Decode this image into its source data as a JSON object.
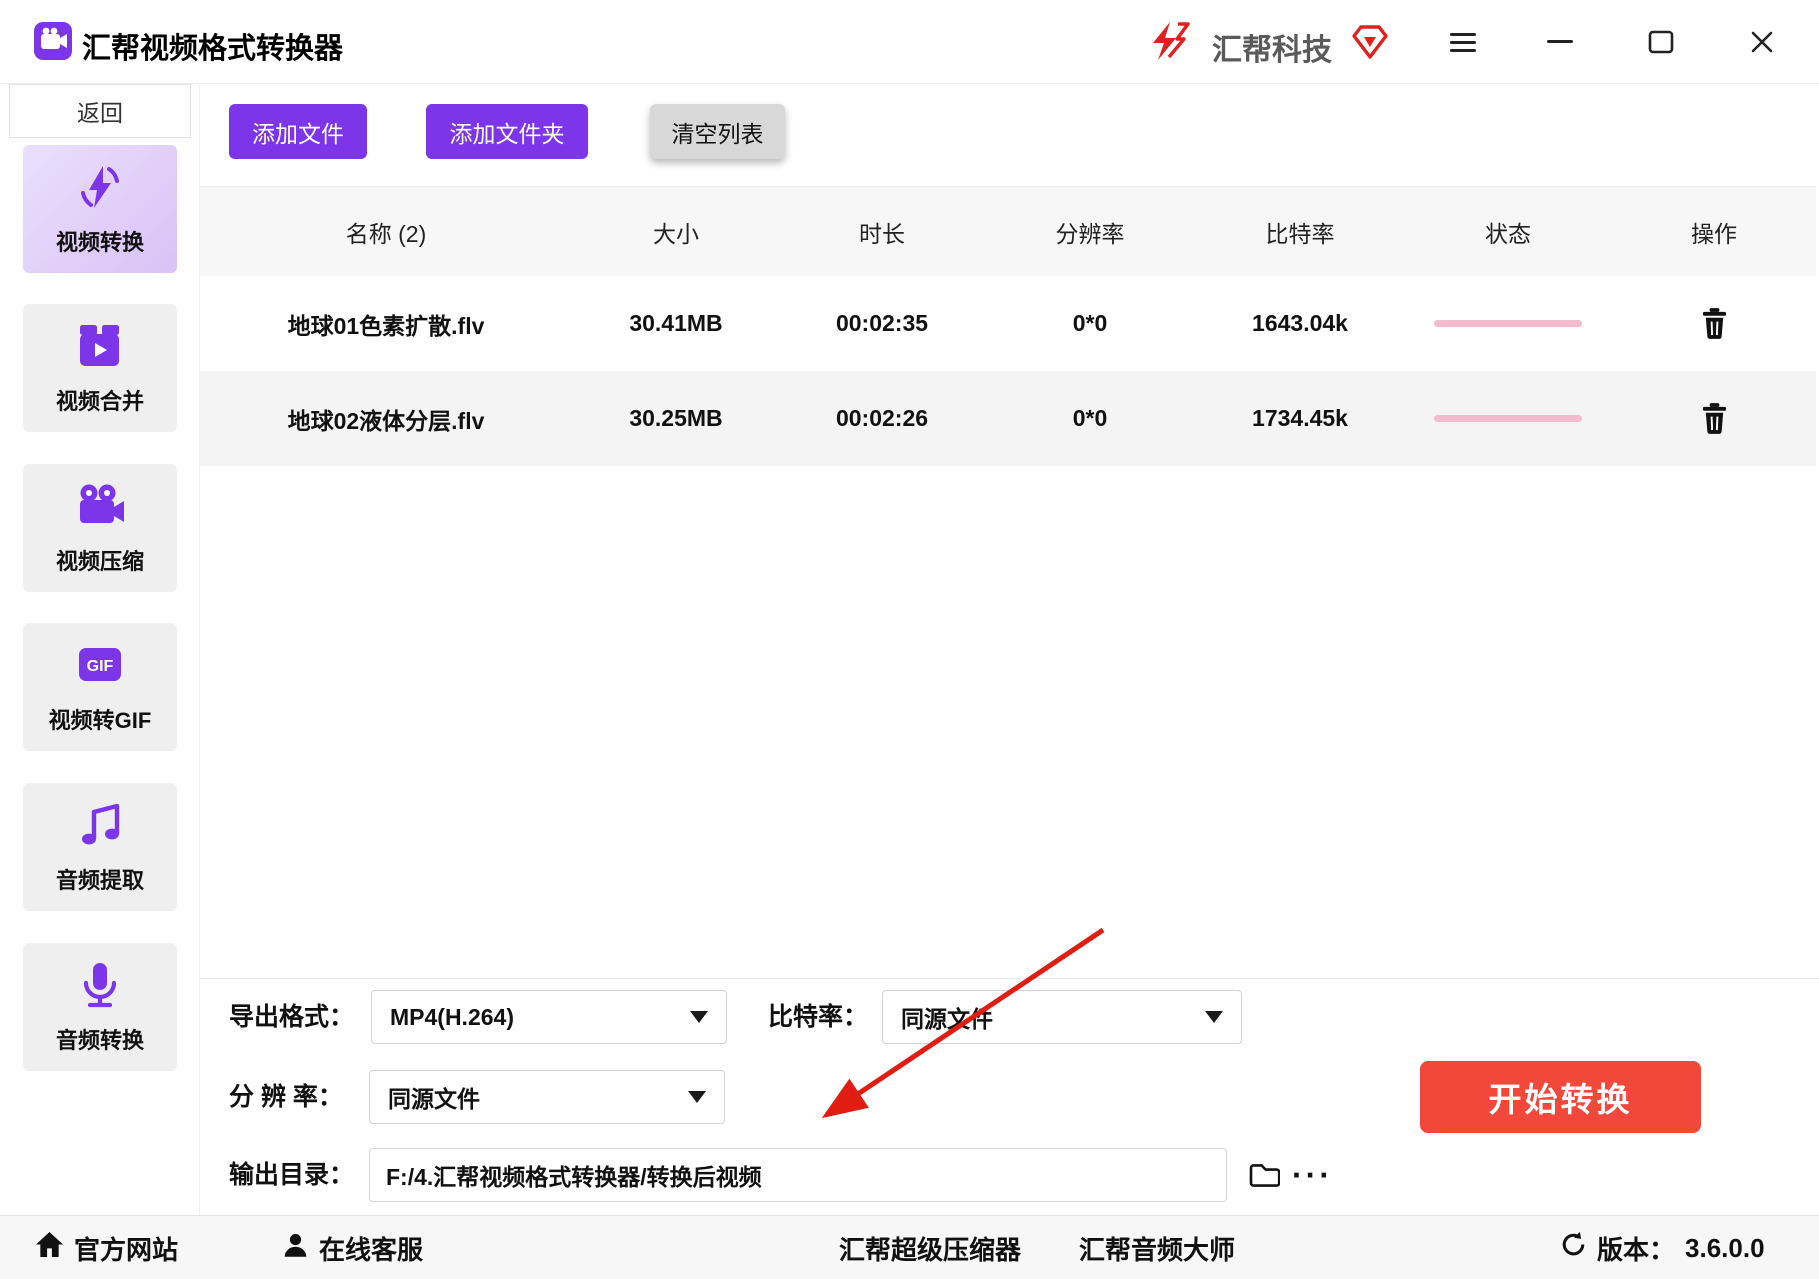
{
  "titlebar": {
    "app_title": "汇帮视频格式转换器",
    "brand_name": "汇帮科技"
  },
  "sidebar": {
    "back_label": "返回",
    "gif_icon_text": "GIF",
    "items": [
      {
        "label": "视频转换"
      },
      {
        "label": "视频合并"
      },
      {
        "label": "视频压缩"
      },
      {
        "label": "视频转GIF"
      },
      {
        "label": "音频提取"
      },
      {
        "label": "音频转换"
      }
    ]
  },
  "toolbar": {
    "add_file": "添加文件",
    "add_folder": "添加文件夹",
    "clear_list": "清空列表"
  },
  "table": {
    "headers": {
      "name": "名称 (2)",
      "size": "大小",
      "duration": "时长",
      "resolution": "分辨率",
      "bitrate": "比特率",
      "status": "状态",
      "action": "操作"
    },
    "rows": [
      {
        "name": "地球01色素扩散.flv",
        "size": "30.41MB",
        "duration": "00:02:35",
        "resolution": "0*0",
        "bitrate": "1643.04k"
      },
      {
        "name": "地球02液体分层.flv",
        "size": "30.25MB",
        "duration": "00:02:26",
        "resolution": "0*0",
        "bitrate": "1734.45k"
      }
    ]
  },
  "settings": {
    "export_format_label": "导出格式：",
    "export_format_value": "MP4(H.264)",
    "bitrate_label": "比特率：",
    "bitrate_value": "同源文件",
    "resolution_label": "分 辨 率：",
    "resolution_value": "同源文件",
    "output_dir_label": "输出目录：",
    "output_dir_value": "F:/4.汇帮视频格式转换器/转换后视频",
    "more_dots": "···",
    "start_button": "开始转换"
  },
  "footer": {
    "official_site": "官方网站",
    "online_support": "在线客服",
    "super_compressor": "汇帮超级压缩器",
    "audio_master": "汇帮音频大师",
    "version_label": "版本：",
    "version_value": "3.6.0.0"
  },
  "colors": {
    "accent_purple": "#7C35E8",
    "start_red": "#F1483B",
    "progress_pink": "#F4BACE",
    "brand_red": "#E0201C"
  }
}
